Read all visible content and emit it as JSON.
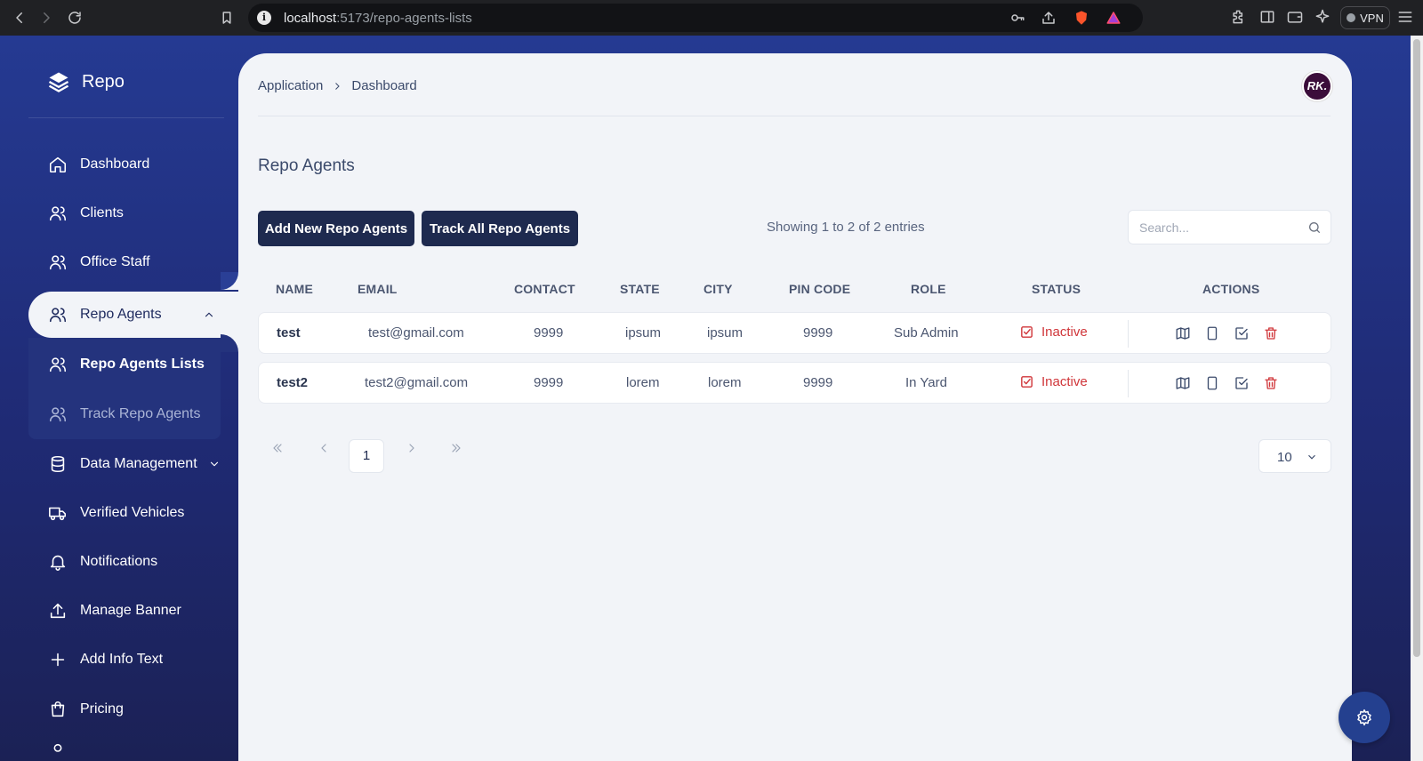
{
  "browser": {
    "url_host": "localhost",
    "url_path": ":5173/repo-agents-lists",
    "vpn_label": "VPN"
  },
  "sidebar": {
    "brand": "Repo",
    "items": [
      {
        "label": "Dashboard",
        "icon": "home-icon"
      },
      {
        "label": "Clients",
        "icon": "users-icon"
      },
      {
        "label": "Office Staff",
        "icon": "users-icon"
      },
      {
        "label": "Repo Agents",
        "icon": "users-icon",
        "active": true,
        "expanded": true
      },
      {
        "label": "Data Management",
        "icon": "database-icon"
      },
      {
        "label": "Verified Vehicles",
        "icon": "truck-icon"
      },
      {
        "label": "Notifications",
        "icon": "bell-icon"
      },
      {
        "label": "Manage Banner",
        "icon": "upload-icon"
      },
      {
        "label": "Add Info Text",
        "icon": "plus-icon"
      },
      {
        "label": "Pricing",
        "icon": "shopping-bag-icon"
      }
    ],
    "sub_items": [
      {
        "label": "Repo Agents Lists",
        "selected": true
      },
      {
        "label": "Track Repo Agents",
        "selected": false
      }
    ]
  },
  "header": {
    "breadcrumb": [
      "Application",
      "Dashboard"
    ],
    "avatar_initials": "RK."
  },
  "page": {
    "title": "Repo Agents",
    "add_button": "Add New Repo Agents",
    "track_button": "Track All Repo Agents",
    "entries_text": "Showing 1 to 2 of 2 entries",
    "search_placeholder": "Search..."
  },
  "table": {
    "columns": [
      "NAME",
      "EMAIL",
      "CONTACT",
      "STATE",
      "CITY",
      "PIN CODE",
      "ROLE",
      "STATUS",
      "ACTIONS"
    ],
    "rows": [
      {
        "name": "test",
        "email": "test@gmail.com",
        "contact": "9999",
        "state": "ipsum",
        "city": "ipsum",
        "pin": "9999",
        "role": "Sub Admin",
        "status": "Inactive"
      },
      {
        "name": "test2",
        "email": "test2@gmail.com",
        "contact": "9999",
        "state": "lorem",
        "city": "lorem",
        "pin": "9999",
        "role": "In Yard",
        "status": "Inactive"
      }
    ]
  },
  "pagination": {
    "current_page": "1",
    "per_page": "10"
  },
  "colors": {
    "sidebar_bg": "#253a92",
    "button_bg": "#1e2a4f",
    "status_inactive": "#d0363a",
    "main_bg": "#f2f4f8"
  }
}
